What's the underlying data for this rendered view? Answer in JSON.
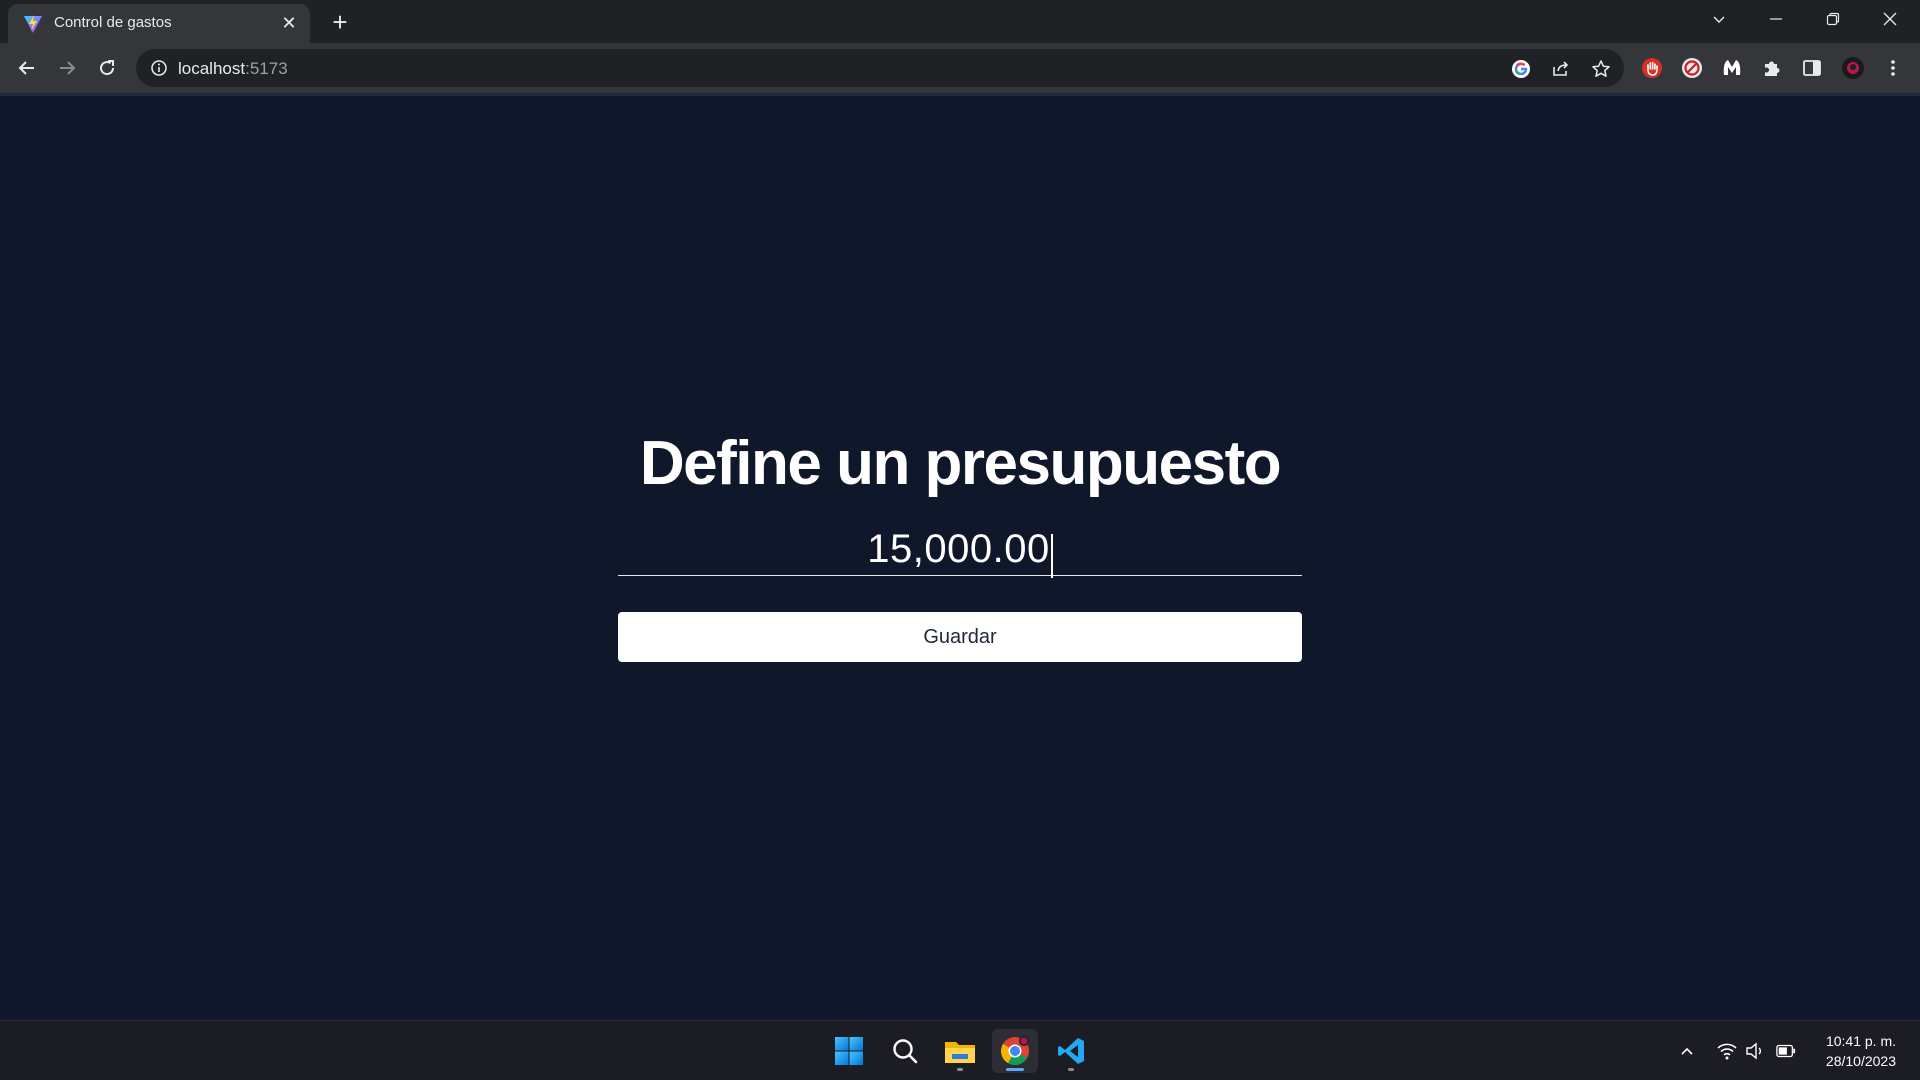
{
  "browser": {
    "tab_title": "Control de gastos",
    "tab_close": "✕",
    "new_tab": "+",
    "url_host": "localhost",
    "url_port": ":5173"
  },
  "page": {
    "heading": "Define un presupuesto",
    "budget_input_value": "15,000.00",
    "save_button_label": "Guardar"
  },
  "taskbar": {
    "time": "10:41 p. m.",
    "date": "28/10/2023"
  },
  "colors": {
    "page_background": "#0f172a",
    "chrome_dark": "#202124",
    "chrome_toolbar": "#35363a",
    "button_background": "#ffffff",
    "taskbar": "#1c1c24"
  },
  "icons": [
    "vite-favicon-icon",
    "close-icon",
    "plus-icon",
    "chevron-down-icon",
    "minimize-icon",
    "restore-icon",
    "window-close-icon",
    "back-arrow-icon",
    "forward-arrow-icon",
    "reload-icon",
    "info-icon",
    "google-icon",
    "share-icon",
    "star-icon",
    "hand-stop-icon",
    "block-icon",
    "malwarebytes-icon",
    "puzzle-icon",
    "side-panel-icon",
    "profile-avatar-icon",
    "kebab-menu-icon",
    "windows-start-icon",
    "search-icon",
    "file-explorer-icon",
    "chrome-icon",
    "vscode-icon",
    "chevron-up-icon",
    "wifi-icon",
    "speaker-icon",
    "battery-icon"
  ]
}
